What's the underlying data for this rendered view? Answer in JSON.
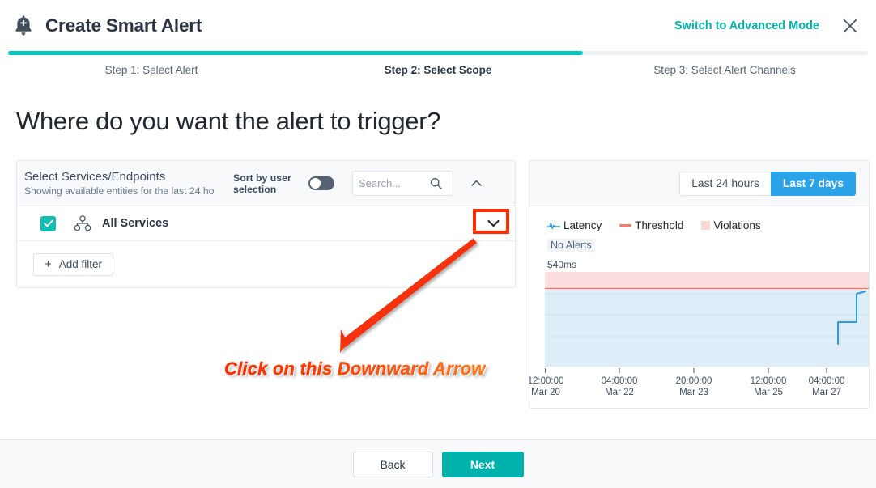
{
  "header": {
    "title": "Create Smart Alert",
    "bell_icon": "bell-plus-icon",
    "advanced_mode_label": "Switch to Advanced Mode",
    "close_icon": "close-icon"
  },
  "stepper": {
    "steps": [
      {
        "label": "Step 1: Select Alert",
        "active": false
      },
      {
        "label": "Step 2: Select Scope",
        "active": true
      },
      {
        "label": "Step 3: Select Alert Channels",
        "active": false
      }
    ],
    "progress_percent": 67,
    "fill_color": "#00c8c0"
  },
  "page": {
    "heading": "Where do you want the alert to trigger?"
  },
  "scope_panel": {
    "title": "Select Services/Endpoints",
    "subtitle": "Showing available entities for the last 24 ho",
    "sort_label": "Sort by user selection",
    "sort_toggle_state": "off",
    "search_placeholder": "Search...",
    "search_value": "",
    "search_icon": "search-icon",
    "collapse_icon": "chevron-up-icon",
    "rows": [
      {
        "label": "All Services",
        "checked": true,
        "icon": "services-hierarchy-icon",
        "expand_icon": "chevron-down-icon"
      }
    ],
    "add_filter_label": "Add filter",
    "add_filter_icon": "plus-icon",
    "checkbox_color": "#0fbdb1"
  },
  "chart_panel": {
    "ranges": [
      {
        "label": "Last 24 hours",
        "active": false
      },
      {
        "label": "Last 7 days",
        "active": true
      }
    ],
    "active_range_color": "#2aa3e8",
    "no_alerts_label": "No Alerts",
    "y_axis_label": "540ms"
  },
  "chart_data": {
    "type": "line",
    "title": "",
    "xlabel": "",
    "ylabel": "540ms",
    "ylim": [
      0,
      540
    ],
    "grid": true,
    "legend_position": "top-left",
    "legend": [
      {
        "name": "Latency",
        "color": "#2e9bde",
        "icon": "pulse-line-icon"
      },
      {
        "name": "Threshold",
        "color": "#f7796d",
        "icon": "line-icon"
      },
      {
        "name": "Violations",
        "color": "#fbd9d7",
        "icon": "square-icon"
      }
    ],
    "threshold": 450,
    "violation_band": [
      450,
      540
    ],
    "x_ticks": [
      {
        "time": "12:00:00",
        "date": "Mar 20"
      },
      {
        "time": "04:00:00",
        "date": "Mar 22"
      },
      {
        "time": "20:00:00",
        "date": "Mar 23"
      },
      {
        "time": "12:00:00",
        "date": "Mar 25"
      },
      {
        "time": "04:00:00",
        "date": "Mar 27"
      }
    ],
    "series": [
      {
        "name": "Latency",
        "color": "#2e9bde",
        "x": [
          "Mar 27 12:00",
          "Mar 27 16:00",
          "Mar 27 20:00",
          "Mar 28 00:00"
        ],
        "values": [
          0,
          135,
          225,
          410
        ]
      }
    ],
    "y_gridlines": [
      135,
      225,
      360,
      410
    ]
  },
  "annotation": {
    "text": "Click on this Downward Arrow",
    "color": "#ff2d00",
    "highlight_target": "chevron-down-icon"
  },
  "footer": {
    "back_label": "Back",
    "next_label": "Next",
    "next_color": "#00b0aa"
  }
}
